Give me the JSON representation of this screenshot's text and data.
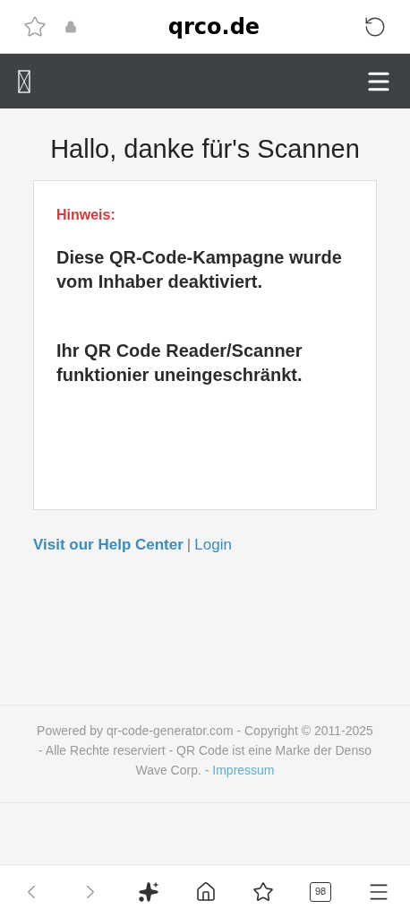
{
  "address_bar": {
    "domain": "qrco.de"
  },
  "page": {
    "heading": "Hallo, danke für's Scannen",
    "card": {
      "label": "Hinweis:",
      "messages": [
        "Diese QR-Code-Kampagne wurde vom Inhaber deaktiviert.",
        "Ihr QR Code Reader/Scanner funktionier uneingeschränkt."
      ]
    },
    "links": [
      {
        "text": "Visit our Help Center",
        "bold": true
      },
      {
        "text": "Login",
        "bold": false
      }
    ],
    "separator": "|"
  },
  "footer": {
    "text": "Powered by qr-code-generator.com - Copyright © 2011-2025 - Alle Rechte reserviert - QR Code ist eine Marke der Denso Wave Corp. -",
    "link": "Impressum"
  },
  "toolbar": {
    "tab_count": "98"
  }
}
